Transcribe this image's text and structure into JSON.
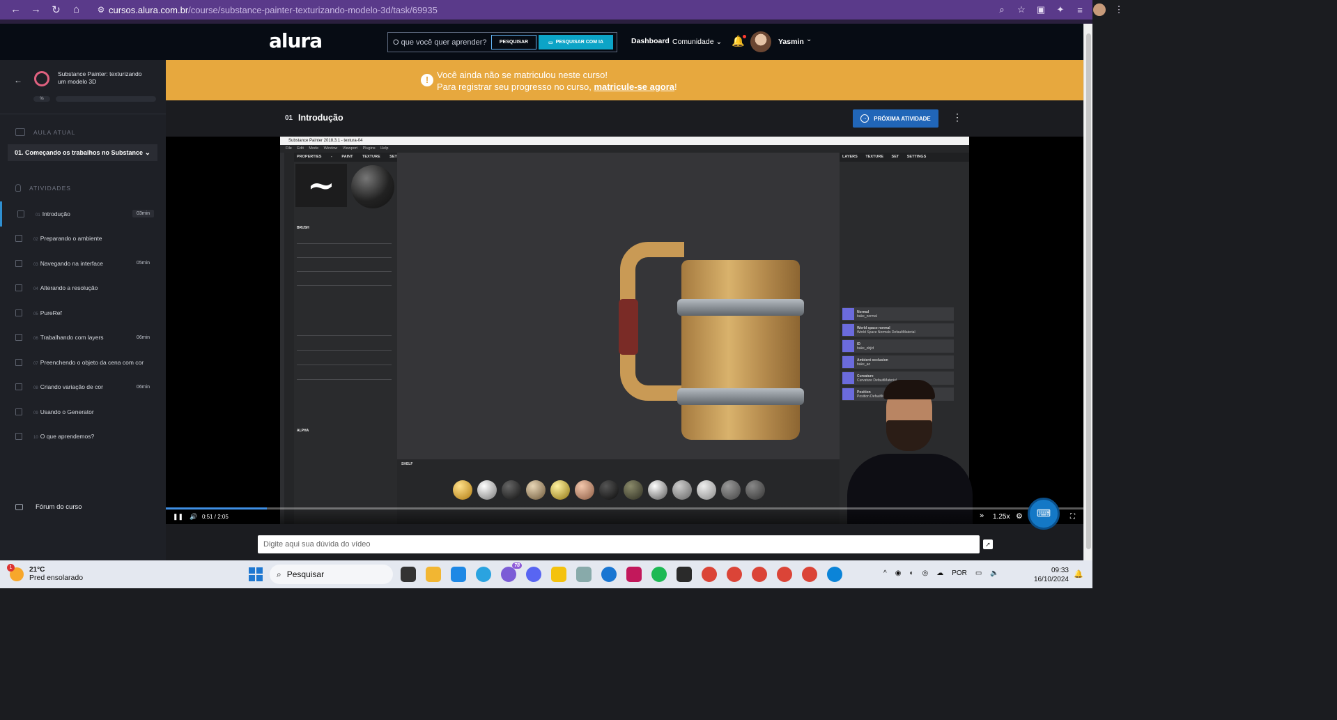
{
  "browser": {
    "url_host": "cursos.alura.com.br",
    "url_path": "/course/substance-painter-texturizando-modelo-3d/task/69935"
  },
  "header": {
    "logo": "alura",
    "search_placeholder": "O que você quer aprender?",
    "search_button": "PESQUISAR",
    "search_ai_button": "PESQUISAR COM IA",
    "nav_dashboard": "Dashboard",
    "nav_community": "Comunidade",
    "user_name": "Yasmin"
  },
  "sidebar": {
    "course_title": "Substance Painter: texturizando um modelo 3D",
    "progress_label": "%",
    "current_section_label": "AULA ATUAL",
    "current_lesson": "01. Começando os trabalhos no Substance",
    "activities_label": "ATIVIDADES",
    "activities": [
      {
        "num": "01",
        "label": "Introdução",
        "duration": "03min",
        "current": true
      },
      {
        "num": "02",
        "label": "Preparando o ambiente",
        "duration": ""
      },
      {
        "num": "03",
        "label": "Navegando na interface",
        "duration": "05min"
      },
      {
        "num": "04",
        "label": "Alterando a resolução",
        "duration": ""
      },
      {
        "num": "05",
        "label": "PureRef",
        "duration": ""
      },
      {
        "num": "06",
        "label": "Trabalhando com layers",
        "duration": "06min"
      },
      {
        "num": "07",
        "label": "Preenchendo o objeto da cena com cor",
        "duration": ""
      },
      {
        "num": "08",
        "label": "Criando variação de cor",
        "duration": "06min"
      },
      {
        "num": "09",
        "label": "Usando o Generator",
        "duration": ""
      },
      {
        "num": "10",
        "label": "O que aprendemos?",
        "duration": ""
      }
    ],
    "forum": "Fórum do curso"
  },
  "banner": {
    "line1": "Você ainda não se matriculou neste curso!",
    "line2_prefix": "Para registrar seu progresso no curso, ",
    "line2_link": "matricule-se agora",
    "line2_suffix": "!"
  },
  "lesson": {
    "number": "01",
    "title": "Introdução",
    "next_button": "PRÓXIMA ATIVIDADE"
  },
  "video": {
    "app_title": "Substance Painter 2018.3.1 - textura-04",
    "menu": "File Edit Mode Window Viewport Plugins Help",
    "left_panel_header": "PROPERTIES - PAINT TEXTURE SET LIST",
    "right_panel_header": "LAYERS TEXTURE SET SETTINGS",
    "brush_label": "BRUSH",
    "alpha_label": "ALPHA",
    "shelf_label": "SHELF",
    "mesh_maps": [
      {
        "name": "Normal",
        "sub": "bake_normal"
      },
      {
        "name": "World space normal",
        "sub": "World Space Normals DefaultMaterial"
      },
      {
        "name": "ID",
        "sub": "bake_objid"
      },
      {
        "name": "Ambient occlusion",
        "sub": "bake_ao"
      },
      {
        "name": "Curvature",
        "sub": "Curvature DefaultMaterial"
      },
      {
        "name": "Position",
        "sub": "Position DefaultMaterial"
      }
    ],
    "time_current": "0:51",
    "time_total": "2:05",
    "speed": "1.25x",
    "progress_fraction": 0.11
  },
  "question_placeholder": "Digite aqui sua dúvida do vídeo",
  "taskbar": {
    "weather_temp": "21°C",
    "weather_desc": "Pred ensolarado",
    "weather_badge": "1",
    "search_label": "Pesquisar",
    "lang": "POR",
    "time": "09:33",
    "date": "16/10/2024",
    "discord_badge": "78"
  }
}
